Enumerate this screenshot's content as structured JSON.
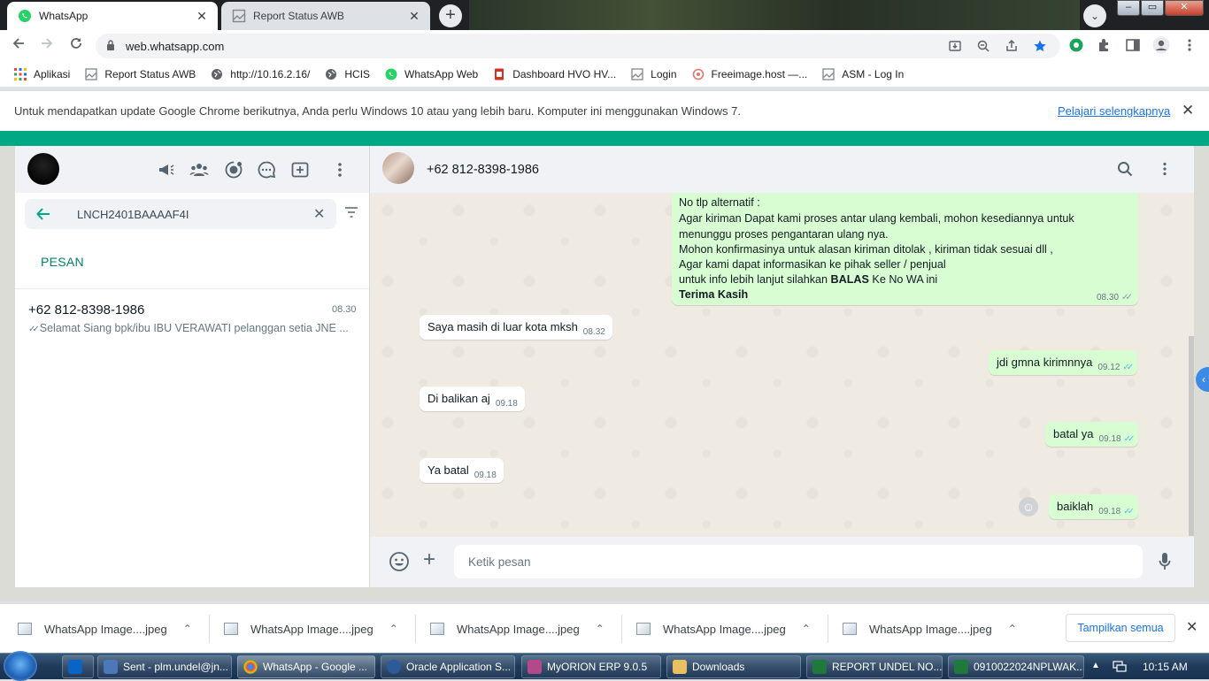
{
  "tabs": [
    {
      "title": "WhatsApp",
      "icon": "whatsapp-icon",
      "active": true
    },
    {
      "title": "Report Status AWB",
      "icon": "broken-image-icon",
      "active": false
    }
  ],
  "address_bar": {
    "url": "web.whatsapp.com"
  },
  "bookmarks": [
    {
      "label": "Aplikasi",
      "icon": "apps-grid-icon"
    },
    {
      "label": "Report Status AWB",
      "icon": "broken-image-icon"
    },
    {
      "label": "http://10.16.2.16/",
      "icon": "globe-icon"
    },
    {
      "label": "HCIS",
      "icon": "globe-icon"
    },
    {
      "label": "WhatsApp Web",
      "icon": "whatsapp-icon"
    },
    {
      "label": "Dashboard HVO HV...",
      "icon": "red-doc-icon"
    },
    {
      "label": "Login",
      "icon": "broken-image-icon"
    },
    {
      "label": "Freeimage.host —...",
      "icon": "freeimage-icon"
    },
    {
      "label": "ASM - Log In",
      "icon": "broken-image-icon"
    }
  ],
  "infobar": {
    "message": "Untuk mendapatkan update Google Chrome berikutnya, Anda perlu Windows 10 atau yang lebih baru. Komputer ini menggunakan Windows 7.",
    "link": "Pelajari selengkapnya"
  },
  "left_panel": {
    "search_value": "LNCH2401BAAAAF4I",
    "section_label": "PESAN",
    "chat": {
      "name": "+62 812-8398-1986",
      "time": "08.30",
      "preview": "Selamat Siang   bpk/ibu IBU VERAWATI pelanggan setia JNE ..."
    }
  },
  "conversation": {
    "contact_name": "+62 812-8398-1986",
    "big_message_lines": [
      "No tlp alternatif :",
      "Agar kiriman Dapat kami proses antar ulang kembali, mohon kesediannya untuk",
      "menunggu proses pengantaran ulang nya.",
      "Mohon konfirmasinya untuk alasan kiriman ditolak , kiriman tidak sesuai dll ,",
      "Agar kami dapat informasikan ke pihak seller / penjual",
      "untuk info lebih lanjut silahkan ",
      "BALAS",
      " Ke No WA ini",
      "Terima Kasih"
    ],
    "big_message_time": "08.30",
    "messages": [
      {
        "dir": "in",
        "text": "Saya masih di luar kota mksh",
        "time": "08.32"
      },
      {
        "dir": "out",
        "text": "jdi gmna kirimnnya",
        "time": "09.12"
      },
      {
        "dir": "in",
        "text": "Di balikan aj",
        "time": "09.18"
      },
      {
        "dir": "out",
        "text": "batal ya",
        "time": "09.18"
      },
      {
        "dir": "in",
        "text": "Ya batal",
        "time": "09.18"
      },
      {
        "dir": "out",
        "text": "baiklah",
        "time": "09.18"
      }
    ],
    "composer_placeholder": "Ketik pesan"
  },
  "downloads": {
    "items": [
      "WhatsApp Image....jpeg",
      "WhatsApp Image....jpeg",
      "WhatsApp Image....jpeg",
      "WhatsApp Image....jpeg",
      "WhatsApp Image....jpeg"
    ],
    "show_all": "Tampilkan semua"
  },
  "taskbar": {
    "items": [
      {
        "label": "Sent - plm.undel@jn...",
        "icon": "outlook-icon",
        "active": false
      },
      {
        "label": "WhatsApp - Google ...",
        "icon": "chrome-icon",
        "active": true
      },
      {
        "label": "Oracle Application S...",
        "icon": "oracle-icon",
        "active": false
      },
      {
        "label": "MyORION ERP 9.0.5",
        "icon": "orion-icon",
        "active": false
      },
      {
        "label": "Downloads",
        "icon": "folder-icon",
        "active": false
      },
      {
        "label": "REPORT UNDEL NO...",
        "icon": "excel-icon",
        "active": false
      },
      {
        "label": "0910022024NPLWAK...",
        "icon": "excel-icon",
        "active": false
      }
    ],
    "clock": "10:15 AM"
  },
  "colors": {
    "wa_green": "#00a884",
    "out_bubble": "#d9fdd3",
    "in_bubble": "#ffffff",
    "chat_bg": "#efeae2",
    "link": "#1a73e8",
    "tick_blue": "#53bdeb"
  }
}
